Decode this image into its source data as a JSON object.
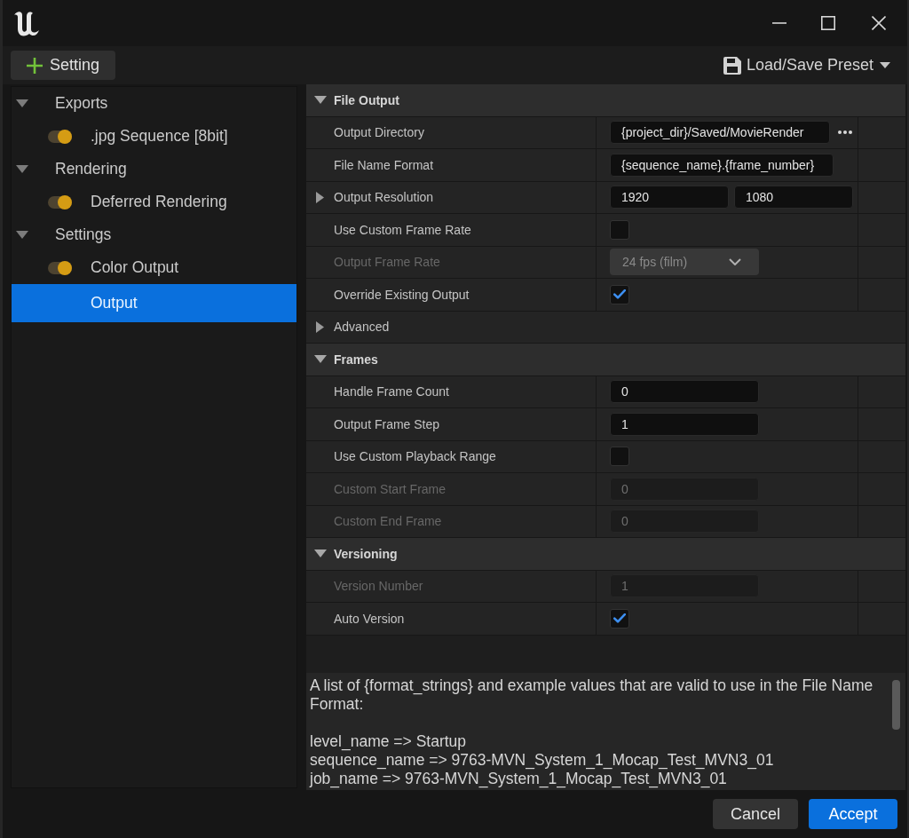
{
  "toolbar": {
    "add_button": "Setting",
    "preset_button": "Load/Save Preset"
  },
  "tree": [
    {
      "label": "Exports",
      "expanded": true,
      "children": [
        {
          "label": ".jpg Sequence [8bit]",
          "kind": "toggle",
          "on": true,
          "selected": false
        }
      ]
    },
    {
      "label": "Rendering",
      "expanded": true,
      "children": [
        {
          "label": "Deferred Rendering",
          "kind": "toggle",
          "on": true,
          "selected": false
        }
      ]
    },
    {
      "label": "Settings",
      "expanded": true,
      "children": [
        {
          "label": "Color Output",
          "kind": "toggle",
          "on": true,
          "selected": false
        },
        {
          "label": "Output",
          "kind": "plain",
          "selected": true
        }
      ]
    }
  ],
  "sections": [
    {
      "title": "File Output",
      "expanded": true,
      "rows": [
        {
          "kind": "path",
          "label": "Output Directory",
          "value": "{project_dir}/Saved/MovieRender",
          "disabled": false
        },
        {
          "kind": "text",
          "label": "File Name Format",
          "value": "{sequence_name}.{frame_number}",
          "disabled": false
        },
        {
          "kind": "vector2",
          "label": "Output Resolution",
          "values": [
            "1920",
            "1080"
          ],
          "expanded": false,
          "disabled": false
        },
        {
          "kind": "checkbox",
          "label": "Use Custom Frame Rate",
          "checked": false,
          "disabled": false
        },
        {
          "kind": "dropdown",
          "label": "Output Frame Rate",
          "value": "24 fps (film)",
          "disabled": true
        },
        {
          "kind": "checkbox",
          "label": "Override Existing Output",
          "checked": true,
          "disabled": false
        },
        {
          "kind": "group",
          "label": "Advanced",
          "expanded": false,
          "disabled": false
        }
      ]
    },
    {
      "title": "Frames",
      "expanded": true,
      "rows": [
        {
          "kind": "number",
          "label": "Handle Frame Count",
          "value": "0",
          "disabled": false
        },
        {
          "kind": "number",
          "label": "Output Frame Step",
          "value": "1",
          "disabled": false
        },
        {
          "kind": "checkbox",
          "label": "Use Custom Playback Range",
          "checked": false,
          "disabled": false
        },
        {
          "kind": "number",
          "label": "Custom Start Frame",
          "value": "0",
          "disabled": true
        },
        {
          "kind": "number",
          "label": "Custom End Frame",
          "value": "0",
          "disabled": true
        }
      ]
    },
    {
      "title": "Versioning",
      "expanded": true,
      "rows": [
        {
          "kind": "number",
          "label": "Version Number",
          "value": "1",
          "disabled": true
        },
        {
          "kind": "checkbox",
          "label": "Auto Version",
          "checked": true,
          "disabled": false
        }
      ]
    }
  ],
  "description": {
    "text": "A list of {format_strings} and example values that are valid to use in the File Name Format:",
    "examples": [
      "level_name => Startup",
      "sequence_name => 9763-MVN_System_1_Mocap_Test_MVN3_01",
      "job_name => 9763-MVN_System_1_Mocap_Test_MVN3_01"
    ]
  },
  "buttons": [
    {
      "label": "Cancel",
      "primary": false
    },
    {
      "label": "Accept",
      "primary": true
    }
  ]
}
